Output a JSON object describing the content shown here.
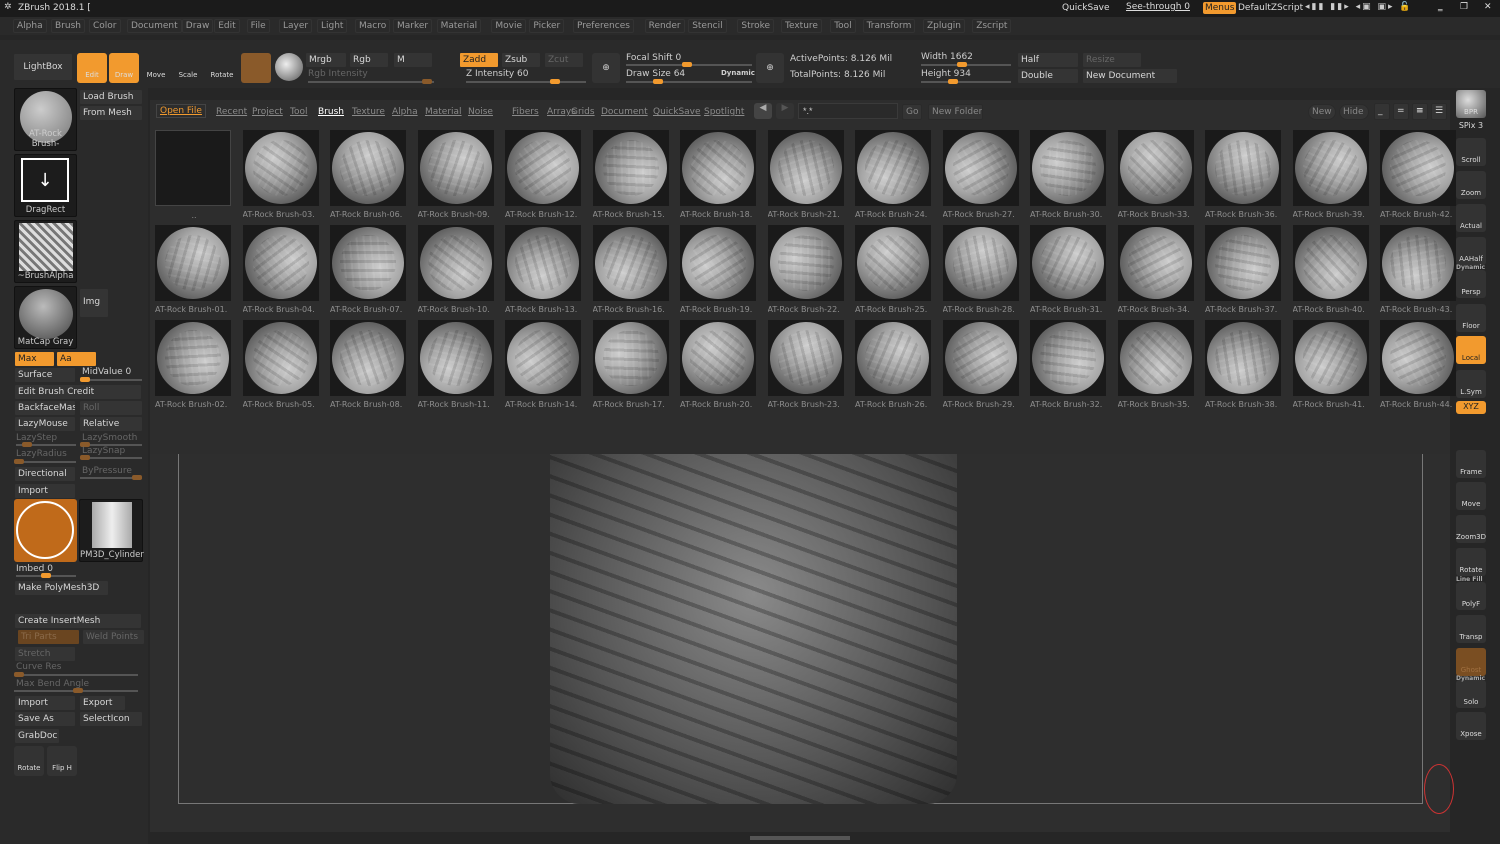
{
  "title": "ZBrush 2018.1 [",
  "titlebar": {
    "quicksave": "QuickSave",
    "seethrough": "See-through  0",
    "menus": "Menus",
    "script": "DefaultZScript"
  },
  "menus": [
    "Alpha",
    "Brush",
    "Color",
    "Document",
    "Draw",
    "Edit",
    "File",
    "Layer",
    "Light",
    "Macro",
    "Marker",
    "Material",
    "Movie",
    "Picker",
    "Preferences",
    "Render",
    "Stencil",
    "Stroke",
    "Texture",
    "Tool",
    "Transform",
    "Zplugin",
    "Zscript"
  ],
  "toolbar": {
    "lightbox": "LightBox",
    "edit": "Edit",
    "draw": "Draw",
    "move": "Move",
    "scale": "Scale",
    "rotate": "Rotate",
    "mrgb": "Mrgb",
    "rgb": "Rgb",
    "m": "M",
    "rgb_intensity": "Rgb Intensity",
    "zadd": "Zadd",
    "zsub": "Zsub",
    "zcut": "Zcut",
    "z_intensity": "Z Intensity 60",
    "focal_shift": "Focal Shift 0",
    "draw_size": "Draw Size 64",
    "dynamic": "Dynamic",
    "active_points": "ActivePoints: 8.126 Mil",
    "total_points": "TotalPoints: 8.126 Mil",
    "width": "Width 1662",
    "height": "Height 934",
    "half": "Half",
    "resize": "Resize",
    "double": "Double",
    "new_document": "New Document"
  },
  "left": {
    "brush_name": "AT-Rock Brush-",
    "load_brush": "Load Brush",
    "from_mesh": "From Mesh",
    "stroke": "DragRect",
    "alpha": "~BrushAlpha",
    "material": "MatCap Gray",
    "img": "Img",
    "max": "Max",
    "aa": "Aa",
    "surface": "Surface",
    "midvalue": "MidValue 0",
    "edit_credit": "Edit Brush Credit",
    "backface": "BackfaceMask",
    "roll": "Roll",
    "lazymouse": "LazyMouse",
    "relative": "Relative",
    "lazystep": "LazyStep",
    "lazysmooth": "LazySmooth",
    "lazyradius": "LazyRadius",
    "lazysnap": "LazySnap",
    "directional": "Directional",
    "bypressure": "ByPressure",
    "import": "Import",
    "pm3d": "PM3D_Cylinder",
    "imbed": "Imbed 0",
    "make_polymesh": "Make PolyMesh3D",
    "create_insert": "Create InsertMesh",
    "tri_parts": "Tri Parts",
    "weld_points": "Weld Points",
    "stretch": "Stretch",
    "curve_res": "Curve Res",
    "max_bend": "Max Bend Angle",
    "import2": "Import",
    "export": "Export",
    "save_as": "Save As",
    "selecticon": "SelectIcon",
    "grabdoc": "GrabDoc",
    "rotate": "Rotate",
    "fliph": "Flip H"
  },
  "lightbox": {
    "tabs": [
      "Open File",
      "Recent",
      "Project",
      "Tool",
      "Brush",
      "Texture",
      "Alpha",
      "Material",
      "Noise",
      "Fibers",
      "Arrays",
      "Grids",
      "Document",
      "QuickSave",
      "Spotlight"
    ],
    "active_tab": "Brush",
    "search_value": "*.*",
    "go": "Go",
    "new_folder": "New Folder",
    "new": "New",
    "hide": "Hide",
    "folder_label": "..",
    "rows": [
      [
        "AT-Rock Brush-03.",
        "AT-Rock Brush-06.",
        "AT-Rock Brush-09.",
        "AT-Rock Brush-12.",
        "AT-Rock Brush-15.",
        "AT-Rock Brush-18.",
        "AT-Rock Brush-21.",
        "AT-Rock Brush-24.",
        "AT-Rock Brush-27.",
        "AT-Rock Brush-30.",
        "AT-Rock Brush-33.",
        "AT-Rock Brush-36.",
        "AT-Rock Brush-39.",
        "AT-Rock Brush-42."
      ],
      [
        "AT-Rock Brush-01.",
        "AT-Rock Brush-04.",
        "AT-Rock Brush-07.",
        "AT-Rock Brush-10.",
        "AT-Rock Brush-13.",
        "AT-Rock Brush-16.",
        "AT-Rock Brush-19.",
        "AT-Rock Brush-22.",
        "AT-Rock Brush-25.",
        "AT-Rock Brush-28.",
        "AT-Rock Brush-31.",
        "AT-Rock Brush-34.",
        "AT-Rock Brush-37.",
        "AT-Rock Brush-40.",
        "AT-Rock Brush-43."
      ],
      [
        "AT-Rock Brush-02.",
        "AT-Rock Brush-05.",
        "AT-Rock Brush-08.",
        "AT-Rock Brush-11.",
        "AT-Rock Brush-14.",
        "AT-Rock Brush-17.",
        "AT-Rock Brush-20.",
        "AT-Rock Brush-23.",
        "AT-Rock Brush-26.",
        "AT-Rock Brush-29.",
        "AT-Rock Brush-32.",
        "AT-Rock Brush-35.",
        "AT-Rock Brush-38.",
        "AT-Rock Brush-41.",
        "AT-Rock Brush-44."
      ]
    ]
  },
  "right": [
    {
      "k": "bpr",
      "l": "BPR"
    },
    {
      "k": "spix",
      "l": "SPix 3"
    },
    {
      "k": "scroll",
      "l": "Scroll"
    },
    {
      "k": "zoom",
      "l": "Zoom"
    },
    {
      "k": "actual",
      "l": "Actual"
    },
    {
      "k": "aahalf",
      "l": "AAHalf"
    },
    {
      "k": "persp",
      "l": "Persp"
    },
    {
      "k": "floor",
      "l": "Floor"
    },
    {
      "k": "local",
      "l": "Local"
    },
    {
      "k": "lsym",
      "l": "L.Sym"
    },
    {
      "k": "xyz",
      "l": "XYZ"
    },
    {
      "k": "frame",
      "l": "Frame"
    },
    {
      "k": "move",
      "l": "Move"
    },
    {
      "k": "zoom3d",
      "l": "Zoom3D"
    },
    {
      "k": "rotate",
      "l": "Rotate"
    },
    {
      "k": "polyf",
      "l": "PolyF"
    },
    {
      "k": "transp",
      "l": "Transp"
    },
    {
      "k": "ghost",
      "l": "Ghost"
    },
    {
      "k": "solo",
      "l": "Solo"
    },
    {
      "k": "xpose",
      "l": "Xpose"
    }
  ],
  "right_extra": {
    "dynamic": "Dynamic",
    "line_fill": "Line Fill",
    "dynamic2": "Dynamic"
  },
  "colors": {
    "accent": "#f29a2e",
    "panel": "#2a2a2a"
  }
}
